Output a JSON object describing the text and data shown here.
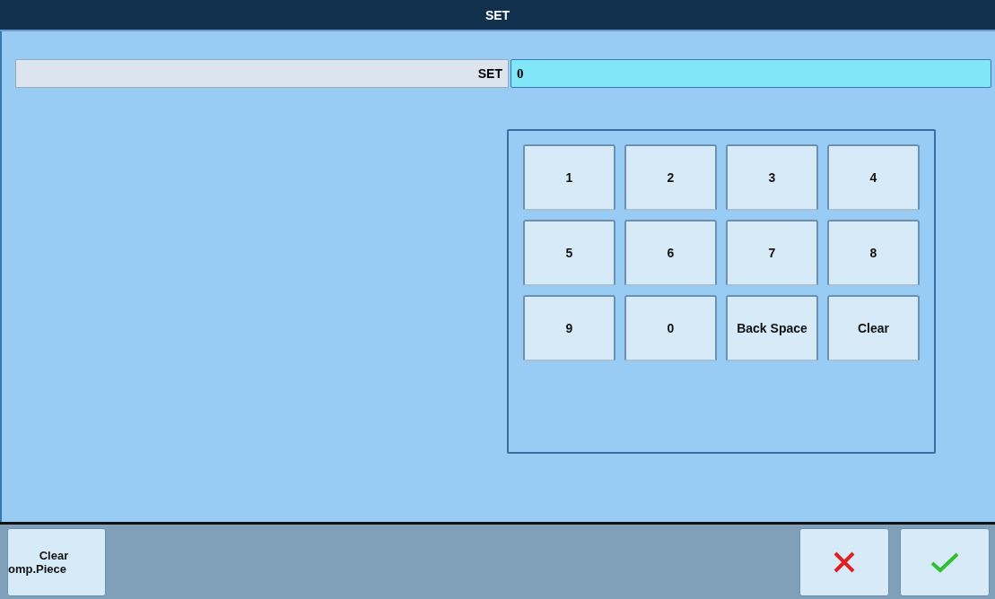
{
  "window": {
    "title": "SET"
  },
  "field": {
    "label": "SET",
    "value": "0"
  },
  "keypad": [
    [
      "1",
      "2",
      "3",
      "4"
    ],
    [
      "5",
      "6",
      "7",
      "8"
    ],
    [
      "9",
      "0",
      "Back Space",
      "Clear"
    ]
  ],
  "footer": {
    "clear_button": [
      "Clear",
      "omp.Piece"
    ],
    "buttons": [
      {
        "kind": "cancel"
      },
      {
        "kind": "ok"
      }
    ]
  }
}
